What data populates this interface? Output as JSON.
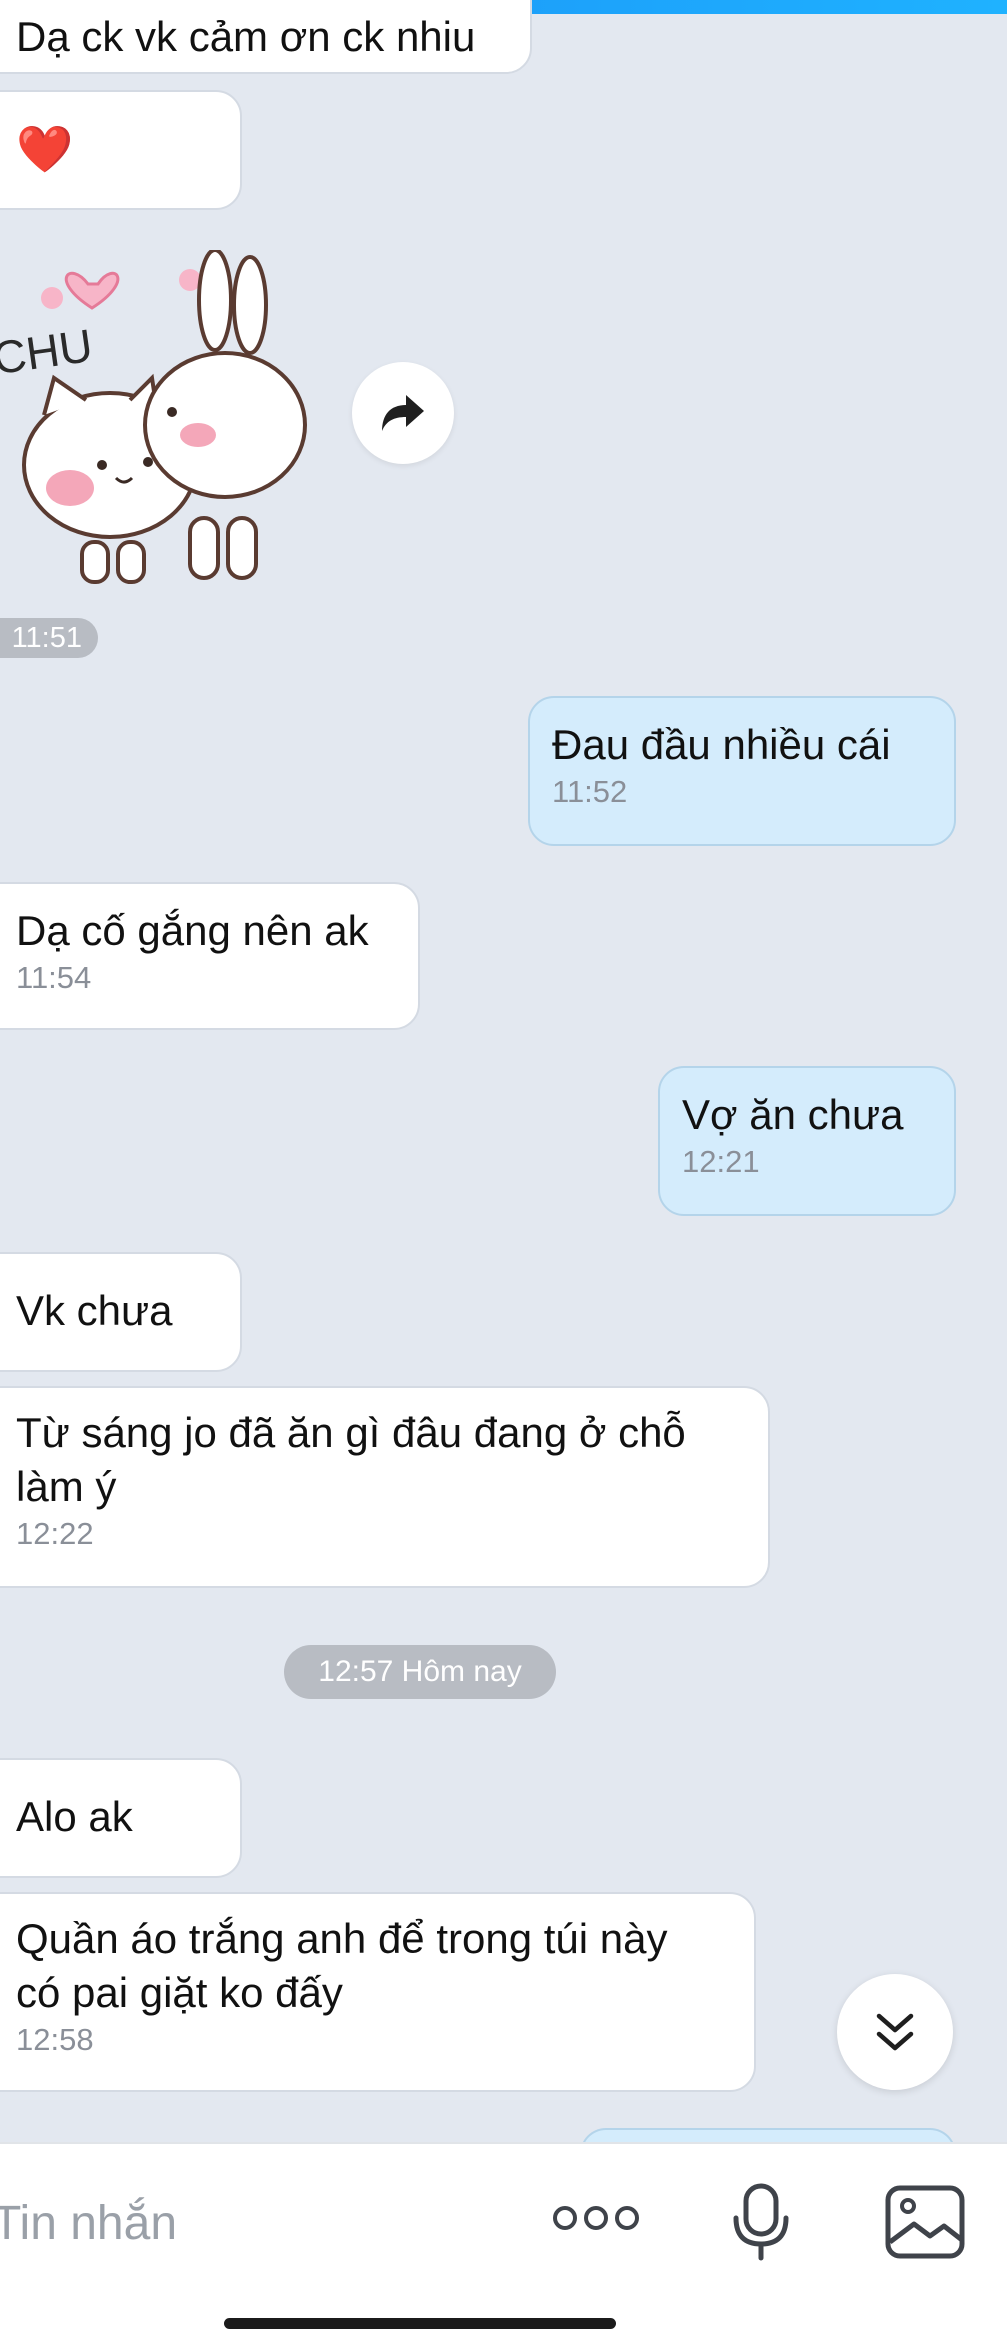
{
  "messages": {
    "m0": {
      "text": "Dạ ck vk cảm ơn ck nhiu"
    },
    "m1": {
      "emoji": "❤️"
    },
    "sticker": {
      "caption": "CHU",
      "time": "11:51"
    },
    "m2": {
      "text": "Đau đầu nhiều cái",
      "time": "11:52"
    },
    "m3": {
      "text": "Dạ cố gắng nên ak",
      "time": "11:54"
    },
    "m4": {
      "text": "Vợ ăn chưa",
      "time": "12:21"
    },
    "m5": {
      "text": "Vk chưa"
    },
    "m6": {
      "text": "Từ sáng jo đã ăn gì đâu đang ở chỗ làm ý",
      "time": "12:22"
    },
    "divider": "12:57 Hôm nay",
    "m7": {
      "text": "Alo ak"
    },
    "m8": {
      "text": "Quần áo trắng anh để trong túi này có pai giặt ko đấy",
      "time": "12:58"
    }
  },
  "input": {
    "placeholder": "Tin nhắn"
  },
  "icons": {
    "forward": "forward-icon",
    "scroll_down": "double-chevron-down-icon",
    "more": "more-dots-icon",
    "mic": "microphone-icon",
    "image": "image-icon"
  },
  "colors": {
    "accent": "#1a8ef5",
    "mine_bubble": "#d4ecfc",
    "background": "#e3e8f0"
  }
}
